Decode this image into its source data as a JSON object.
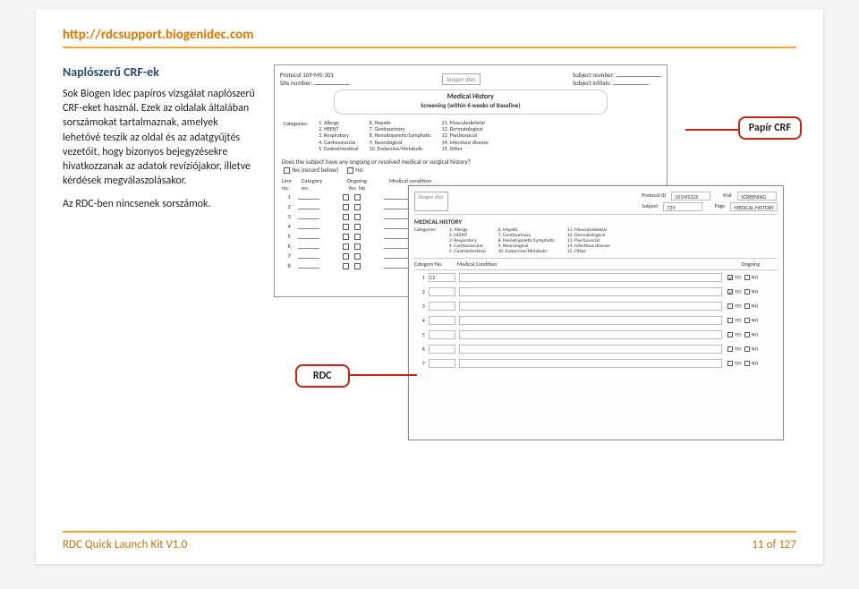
{
  "header": {
    "url": "http://rdcsupport.biogenidec.com"
  },
  "left": {
    "title": "Naplószerű CRF-ek",
    "p1": "Sok Biogen Idec papíros vizsgálat naplószerű CRF-eket használ. Ezek az oldalak általában sorszámokat tartalmaznak, amelyek lehetővé teszik az oldal és az adatgyűjtés vezetőit, hogy bizonyos bejegyzésekre hivatkozzanak az adatok revíziójakor, illetve kérdések megválaszolásakor.",
    "p2": "Az RDC-ben nincsenek sorszámok."
  },
  "paper": {
    "protocol_label": "Protocol 109-MS-301",
    "subj_num_label": "Subject number:",
    "site_label": "Site number:",
    "subj_init_label": "Subject initials:",
    "logo": "biogen idec",
    "title": "Medical History",
    "subtitle": "Screening (within 6 weeks of Baseline)",
    "cat_label": "Categories:",
    "cats_a": [
      "1. Allergy",
      "2. HEENT",
      "3. Respiratory",
      "4. Cardiovascular",
      "5. Gastrointestinal"
    ],
    "cats_b": [
      "6. Hepatic",
      "7. Genitourinary",
      "8. Hematopoietic/Lymphatic",
      "9. Neurological",
      "10. Endocrine/Metabolic"
    ],
    "cats_c": [
      "11. Musculoskeletal",
      "12. Dermatological",
      "13. Psychosocial",
      "14. Infectious disease",
      "15. Other"
    ],
    "question": "Does the subject have any ongoing or resolved medical or surgical history?",
    "yes_label": "Yes (record below)",
    "no_label": "No",
    "ongoing_label": "Ongoing",
    "col_line": "Line no.",
    "col_cat": "Category no.",
    "col_yes": "Yes",
    "col_no": "No",
    "col_cond": "Medical condition",
    "rows": [
      "1",
      "2",
      "3",
      "4",
      "5",
      "6",
      "7",
      "8"
    ]
  },
  "rdc": {
    "logo": "biogen idec",
    "proto_label": "Protocol ID",
    "proto_val": "101MS325",
    "visit_label": "Visit",
    "visit_val": "SCREENING",
    "subj_label": "Subject",
    "subj_val": "729",
    "page_label": "Page",
    "page_val": "MEDICAL HISTORY",
    "section": "MEDICAL HISTORY",
    "cat_label": "Categories:",
    "cats_a": [
      "1. Allergy",
      "2. HEENT",
      "3. Respiratory",
      "4. Cardiovascular",
      "5. Gastrointestinal"
    ],
    "cats_b": [
      "6. Hepatic",
      "7. Genitourinary",
      "8. Hematopoietic/Lymphatic",
      "9. Neurological",
      "10. Endocrine/Metabolic"
    ],
    "cats_c": [
      "11. Musculoskeletal",
      "12. Dermatological",
      "13. Psychosocial",
      "14. Infectious disease",
      "15. Other"
    ],
    "col_cat": "Category No.",
    "col_cond": "Medical Condition",
    "col_ong": "Ongoing",
    "yes": "YES",
    "no": "NO",
    "rows": [
      {
        "n": "1",
        "cat": "12",
        "checked": "yes"
      },
      {
        "n": "2",
        "cat": "",
        "checked": "yes"
      },
      {
        "n": "3",
        "cat": "",
        "checked": ""
      },
      {
        "n": "4",
        "cat": "",
        "checked": ""
      },
      {
        "n": "5",
        "cat": "",
        "checked": ""
      },
      {
        "n": "6",
        "cat": "",
        "checked": ""
      },
      {
        "n": "7",
        "cat": "",
        "checked": ""
      }
    ]
  },
  "callouts": {
    "papir": "Papír CRF",
    "rdc": "RDC"
  },
  "footer": {
    "left": "RDC Quick Launch Kit V1.0",
    "right": "11 of 127"
  }
}
